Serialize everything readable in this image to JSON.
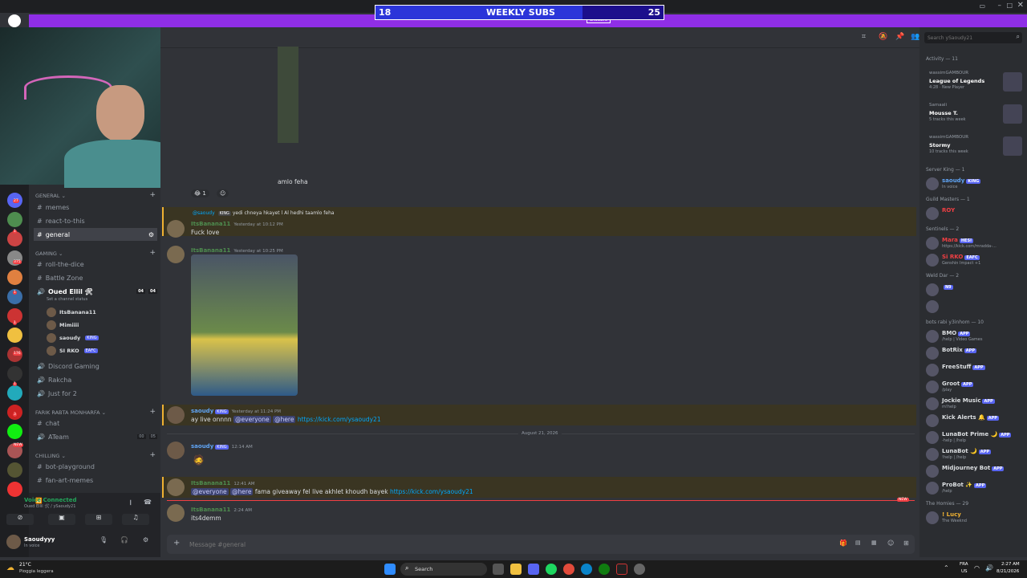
{
  "overlay": {
    "subs_left": "18",
    "title": "WEEKLY SUBS",
    "subs_right": "25",
    "sub_banner_button": "Disable",
    "sub_fill_fraction": 0.72
  },
  "guild_badges": [
    "27",
    "1",
    "375",
    "1",
    "1",
    "176",
    "1",
    "3",
    "NEW"
  ],
  "sidebar": {
    "categories": [
      {
        "label": "General",
        "key": "general"
      },
      {
        "label": "GAMING",
        "key": "gaming"
      },
      {
        "label": "FARIK RABTA MONHARFA",
        "key": "farik"
      },
      {
        "label": "CHILLING",
        "key": "chilling"
      }
    ],
    "channels": {
      "memes": "memes",
      "react": "react-to-this",
      "general": "general",
      "roll": "roll-the-dice",
      "battle": "Battle Zone",
      "voice_main": "Oued Ellil 🛠",
      "voice_status": "Set a channel status",
      "voice_count_a": "04",
      "voice_count_b": "04",
      "voice_users": [
        {
          "name": "ItsBanana11",
          "tag": ""
        },
        {
          "name": "Mimiiii",
          "tag": ""
        },
        {
          "name": "saoudy",
          "tag": "KING"
        },
        {
          "name": "SI RKO",
          "tag": "EAFC"
        }
      ],
      "discord_gaming": "Discord Gaming",
      "rakcha": "Rakcha",
      "just": "Just for 2",
      "chat": "chat",
      "ateam": "ATeam",
      "ateam_a": "00",
      "ateam_b": "05",
      "botplay": "bot-playground",
      "fanart": "fan-art-memes"
    },
    "voice_connected": "Voice Connected",
    "voice_channel": "Oued Ellil 🛠 / ySaoudy21",
    "user": {
      "name": "Saoudyyy",
      "status": "In voice"
    }
  },
  "chat": {
    "reply_trail": "amlo feha",
    "reaction_count": "1",
    "messages": [
      {
        "reply_user": "@saoudy",
        "reply_tag": "KING",
        "reply_text": "yedi chneya hkayet l Al hedhi taamlo feha",
        "user": "ItsBanana11",
        "time": "Yesterday at 10:12 PM",
        "text": "Fuck love"
      },
      {
        "user": "ItsBanana11",
        "time": "Yesterday at 10:25 PM",
        "text": ""
      },
      {
        "user": "saoudy",
        "tag": "KING",
        "time": "Yesterday at 11:24 PM",
        "pre": "ay live onnnn",
        "m1": "@everyone",
        "m2": "@here",
        "link": "https://kick.com/ysaoudy21"
      },
      {
        "user": "saoudy",
        "tag": "KING",
        "time": "12:14 AM"
      },
      {
        "user": "ItsBanana11",
        "time": "12:41 AM",
        "m1": "@everyone",
        "m2": "@here",
        "mid": "fama giveaway fel live akhlet khoudh bayek",
        "link": "https://kick.com/ysaoudy21"
      },
      {
        "user": "ItsBanana11",
        "time": "2:24 AM",
        "text": "its4demm"
      }
    ],
    "date_divider": "August 21, 2026",
    "new_badge": "NEW",
    "input_placeholder": "Message #general"
  },
  "header": {
    "search_placeholder": "Search ySaoudy21"
  },
  "members": {
    "activity_header": "Activity — 11",
    "activity": [
      {
        "user": "wassimGAMBOUR",
        "title": "League of Legends",
        "sub": "4:28 · New Player"
      },
      {
        "user": "Samaali",
        "title": "Mousse T.",
        "sub": "5 tracks this week"
      },
      {
        "user": "wassimGAMBOUR",
        "title": "Stormy",
        "sub": "10 tracks this week"
      }
    ],
    "groups": [
      {
        "header": "Server King — 1",
        "items": [
          {
            "name": "saoudy",
            "tag": "KING",
            "sub": "In voice"
          }
        ]
      },
      {
        "header": "Guild Masters — 1",
        "items": [
          {
            "name": "ROY",
            "tag": "",
            "sub": ""
          }
        ]
      },
      {
        "header": "Sentinels — 2",
        "items": [
          {
            "name": "Mara",
            "tag": "HESI",
            "sub": "https://kick.com/mradda-..."
          },
          {
            "name": "Si RKO",
            "tag": "EAFC",
            "sub": "Genshin Impact +1"
          }
        ]
      },
      {
        "header": "Weld Dar — 2",
        "items": [
          {
            "name": "",
            "tag": "N9",
            "sub": ""
          },
          {
            "name": "",
            "tag": "",
            "sub": ""
          }
        ]
      },
      {
        "header": "bots rabi y3inhom — 10",
        "items": [
          {
            "name": "BMO",
            "tag": "APP",
            "sub": "/help | Video Games"
          },
          {
            "name": "BotRix",
            "tag": "APP",
            "sub": ""
          },
          {
            "name": "FreeStuff",
            "tag": "APP",
            "sub": ""
          },
          {
            "name": "Groot",
            "tag": "APP",
            "sub": "/play"
          },
          {
            "name": "Jockie Music",
            "tag": "APP",
            "sub": "m!help"
          },
          {
            "name": "Kick Alerts 🔔",
            "tag": "APP",
            "sub": ""
          },
          {
            "name": "LunaBot Prime 🌙",
            "tag": "APP",
            "sub": "-help | /help"
          },
          {
            "name": "LunaBot 🌙",
            "tag": "APP",
            "sub": "!help | /help"
          },
          {
            "name": "Midjourney Bot",
            "tag": "APP",
            "sub": ""
          },
          {
            "name": "ProBot ✨",
            "tag": "APP",
            "sub": "/help"
          }
        ]
      },
      {
        "header": "The Homies — 29",
        "items": [
          {
            "name": "! Lucy",
            "tag": "",
            "sub": "The Weeknd"
          }
        ]
      }
    ]
  },
  "taskbar": {
    "weather_temp": "21°C",
    "weather_text": "Pioggia leggera",
    "search": "Search",
    "lang1": "FRA",
    "lang2": "US",
    "time": "2:27 AM",
    "date": "8/21/2026"
  }
}
